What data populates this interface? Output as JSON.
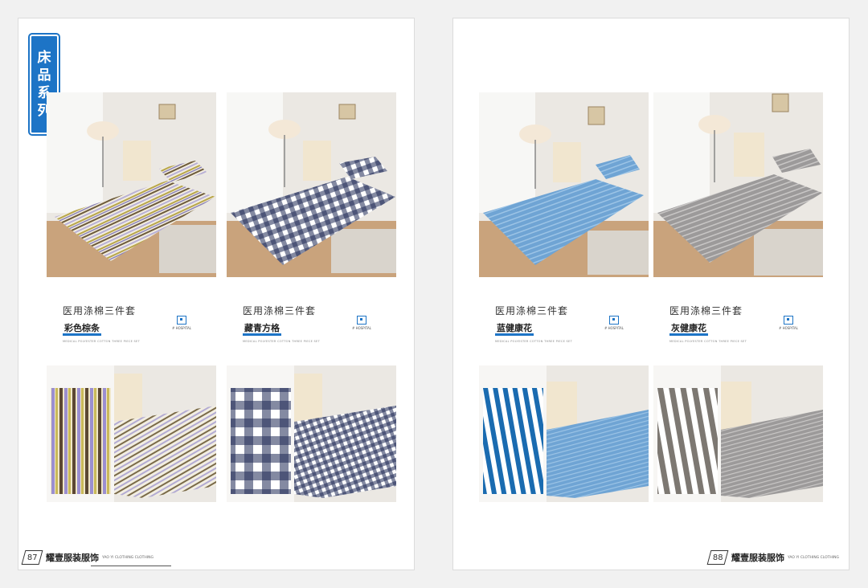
{
  "section_ribbon": [
    "床",
    "品",
    "系",
    "列"
  ],
  "pages": [
    {
      "page_number": "87",
      "brand": "耀壹服装服饰",
      "brand_sub": "YAO YI CLOTHING CLOTHING",
      "products": [
        {
          "category": "医用涤棉三件套",
          "name": "彩色棕条",
          "desc": "MEDICAL POLYESTER COTTON THREE PIECE SET",
          "hosp_label": "# HOSPITAL",
          "pattern": "stripes"
        },
        {
          "category": "医用涤棉三件套",
          "name": "藏青方格",
          "desc": "MEDICAL POLYESTER COTTON THREE PIECE SET",
          "hosp_label": "# HOSPITAL",
          "pattern": "plaid"
        }
      ]
    },
    {
      "page_number": "88",
      "brand": "耀壹服装服饰",
      "brand_sub": "YAO YI CLOTHING CLOTHING",
      "products": [
        {
          "category": "医用涤棉三件套",
          "name": "蓝健康花",
          "desc": "MEDICAL POLYESTER COTTON THREE PIECE SET",
          "hosp_label": "# HOSPITAL",
          "pattern": "blue"
        },
        {
          "category": "医用涤棉三件套",
          "name": "灰健康花",
          "desc": "MEDICAL POLYESTER COTTON THREE PIECE SET",
          "hosp_label": "# HOSPITAL",
          "pattern": "gray"
        }
      ]
    }
  ],
  "colors": {
    "accent": "#1d74c6",
    "floor": "#c9a37c",
    "wall": "#eae7e2"
  }
}
